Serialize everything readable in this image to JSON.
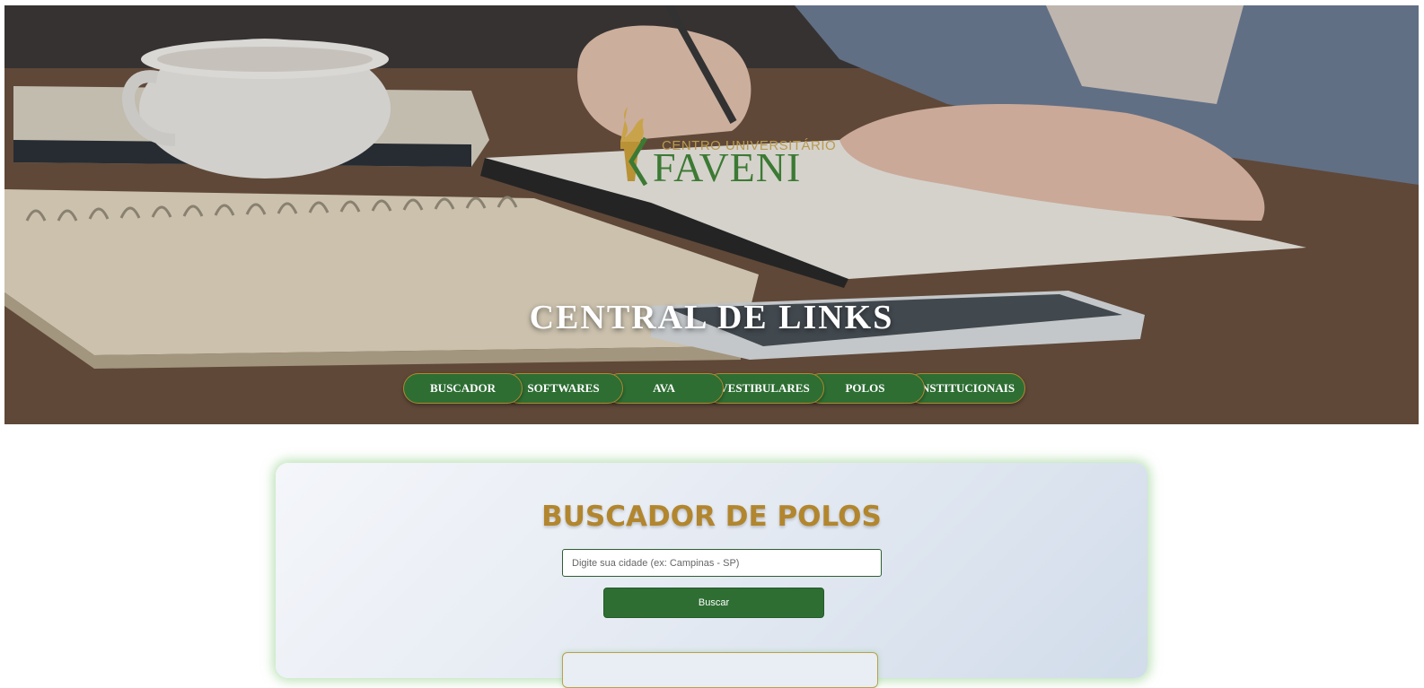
{
  "hero": {
    "logo": {
      "top_text": "CENTRO UNIVERSITÁRIO",
      "main_text": "FAVENI"
    },
    "title": "CENTRAL DE LINKS",
    "nav": [
      {
        "label": "BUSCADOR"
      },
      {
        "label": "SOFTWARES"
      },
      {
        "label": "AVA"
      },
      {
        "label": "VESTIBULARES"
      },
      {
        "label": "POLOS"
      },
      {
        "label": "INSTITUCIONAIS"
      }
    ]
  },
  "search": {
    "title": "BUSCADOR DE POLOS",
    "placeholder": "Digite sua cidade (ex: Campinas - SP)",
    "value": "",
    "button_label": "Buscar"
  },
  "colors": {
    "brand_green": "#2e6e33",
    "brand_gold": "#b2862e"
  }
}
